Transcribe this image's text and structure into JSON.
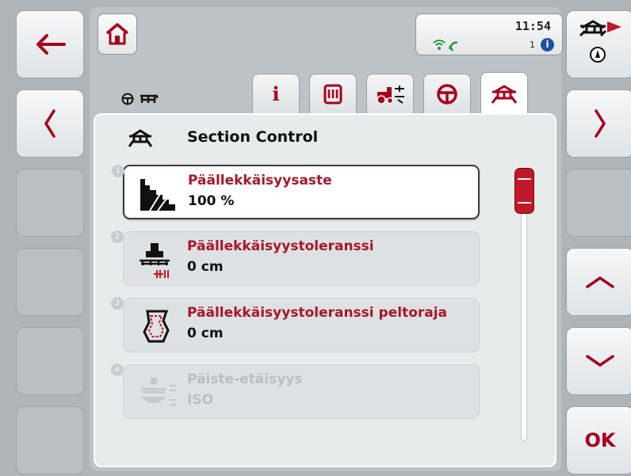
{
  "status": {
    "time": "11:54",
    "counter": "1",
    "info_glyph": "i"
  },
  "panel": {
    "title": "Section Control"
  },
  "items": [
    {
      "number": "1",
      "title": "Päällekkäisyysaste",
      "value": "100 %",
      "state": "selected"
    },
    {
      "number": "2",
      "title": "Päällekkäisyystoleranssi",
      "value": "0 cm",
      "state": "normal"
    },
    {
      "number": "3",
      "title": "Päällekkäisyystoleranssi peltoraja",
      "value": "0 cm",
      "state": "normal"
    },
    {
      "number": "4",
      "title": "Päiste-etäisyys",
      "value": "ISO",
      "state": "disabled"
    }
  ],
  "tabs": [
    {
      "icon": "info-icon",
      "label": "i"
    },
    {
      "icon": "machine-data-icon"
    },
    {
      "icon": "tractor-settings-icon"
    },
    {
      "icon": "steering-wheel-icon"
    },
    {
      "icon": "section-control-icon",
      "active": true
    }
  ],
  "softkeys": {
    "ok_label": "OK"
  },
  "colors": {
    "accent_red": "#a8172a",
    "scroll_red": "#c01828",
    "background": "#aeb4b7"
  }
}
